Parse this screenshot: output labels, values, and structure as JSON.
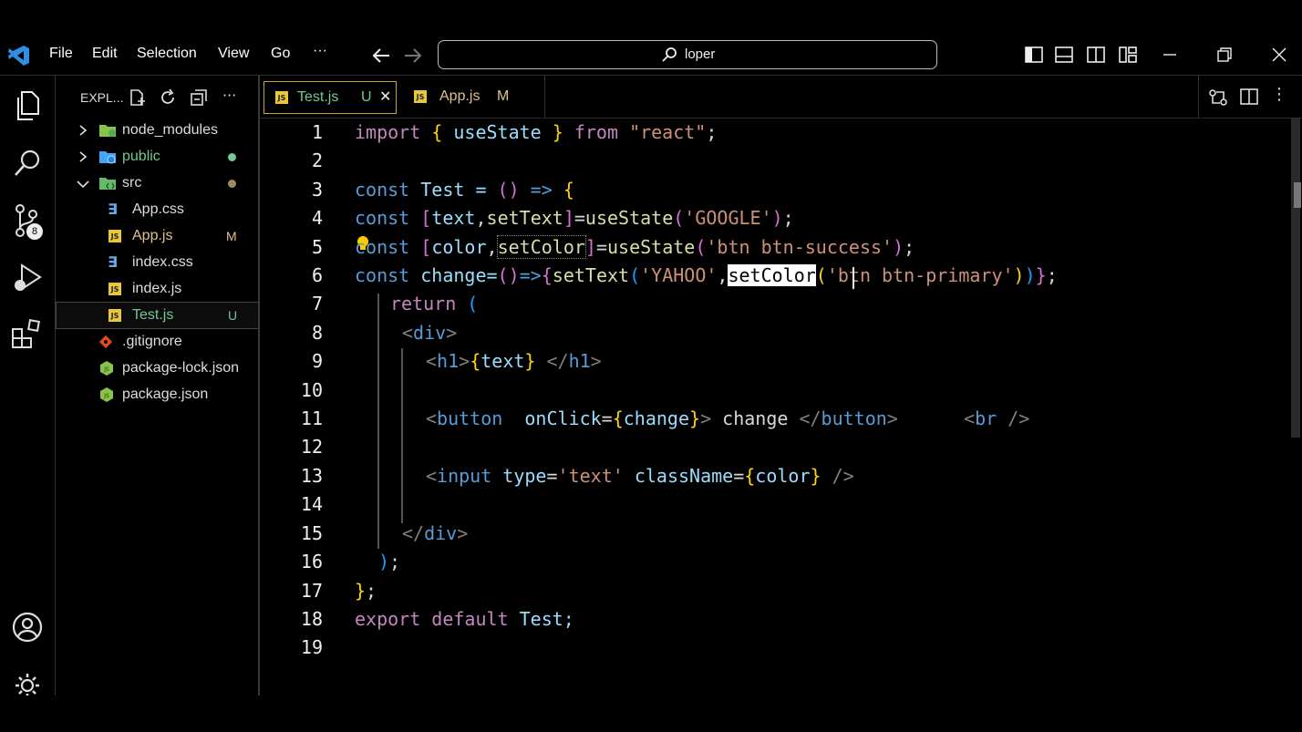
{
  "menu": {
    "file": "File",
    "edit": "Edit",
    "selection": "Selection",
    "view": "View",
    "go": "Go",
    "more": "···"
  },
  "search": {
    "text": "loper"
  },
  "activity": {
    "source_control_badge": "8"
  },
  "explorer": {
    "title": "EXPL...",
    "items": [
      {
        "label": "node_modules",
        "badge": ""
      },
      {
        "label": "public",
        "badge": ""
      },
      {
        "label": "src",
        "badge": ""
      },
      {
        "label": "App.css",
        "badge": ""
      },
      {
        "label": "App.js",
        "badge": "M"
      },
      {
        "label": "index.css",
        "badge": ""
      },
      {
        "label": "index.js",
        "badge": ""
      },
      {
        "label": "Test.js",
        "badge": "U"
      },
      {
        "label": ".gitignore",
        "badge": ""
      },
      {
        "label": "package-lock.json",
        "badge": ""
      },
      {
        "label": "package.json",
        "badge": ""
      }
    ]
  },
  "tabs": [
    {
      "label": "Test.js",
      "badge": "U",
      "close": "✕"
    },
    {
      "label": "App.js",
      "badge": "M"
    }
  ],
  "colors": {
    "accent_badge_untracked": "#73c991",
    "badge_modified": "#e2c08d",
    "js_icon": "#e8c83a"
  },
  "editor": {
    "line_numbers": [
      "1",
      "2",
      "3",
      "4",
      "5",
      "6",
      "7",
      "8",
      "9",
      "10",
      "11",
      "12",
      "13",
      "14",
      "15",
      "16",
      "17",
      "18",
      "19"
    ],
    "lines": {
      "l1": {
        "a": "import",
        "b": " ",
        "c": "{",
        "d": " useState ",
        "e": "}",
        "f": " from ",
        "g": "\"react\"",
        "h": ";"
      },
      "l3": {
        "a": "const",
        "b": " Test = ",
        "c": "()",
        "d": " => ",
        "e": "{"
      },
      "l4": {
        "a": "const",
        "b": " ",
        "c": "[",
        "d": "text",
        "e": ",",
        "f": "setText",
        "g": "]",
        "h": "=",
        "i": "useState",
        "j": "(",
        "k": "'GOOGLE'",
        "l": ")",
        "m": ";"
      },
      "l5": {
        "a": "const",
        "b": " ",
        "c": "[",
        "d": "color",
        "e": ",",
        "f": "setColor",
        "g": "]",
        "h": "=",
        "i": "useState",
        "j": "(",
        "k": "'btn btn-success'",
        "l": ")",
        "m": ";"
      },
      "l6": {
        "a": "const",
        "b": " change=",
        "c": "()",
        "d": "=>",
        "e": "{",
        "f": "setText",
        "g": "(",
        "h": "'YAHOO'",
        "i": ",",
        "j": "setColor",
        "k": "(",
        "l": "'btn btn-primary'",
        "m": ")",
        "n": ")",
        "o": "}",
        "p": ";"
      },
      "l7": {
        "a": "return",
        "b": " ",
        "c": "("
      },
      "l8": {
        "a": "<",
        "b": "div",
        "c": ">"
      },
      "l9": {
        "a": "<",
        "b": "h1",
        "c": ">",
        "d": "{",
        "e": "text",
        "f": "}",
        "g": " </",
        "h": "h1",
        "i": ">"
      },
      "l11": {
        "a": "<",
        "b": "button",
        "c": "  onClick",
        "d": "=",
        "e": "{",
        "f": "change",
        "g": "}",
        "h": ">",
        "i": " change ",
        "j": "</",
        "k": "button",
        "l": ">",
        "m": "      <",
        "n": "br",
        "o": " />"
      },
      "l13": {
        "a": "<",
        "b": "input",
        "c": " type",
        "d": "=",
        "e": "'text'",
        "f": " className",
        "g": "=",
        "h": "{",
        "i": "color",
        "j": "}",
        "k": " />"
      },
      "l15": {
        "a": "</",
        "b": "div",
        "c": ">"
      },
      "l16": {
        "a": ")",
        "b": ";"
      },
      "l17": {
        "a": "}",
        "b": ";"
      },
      "l18": {
        "a": "export",
        "b": " ",
        "c": "default",
        "d": " Test;"
      }
    }
  }
}
